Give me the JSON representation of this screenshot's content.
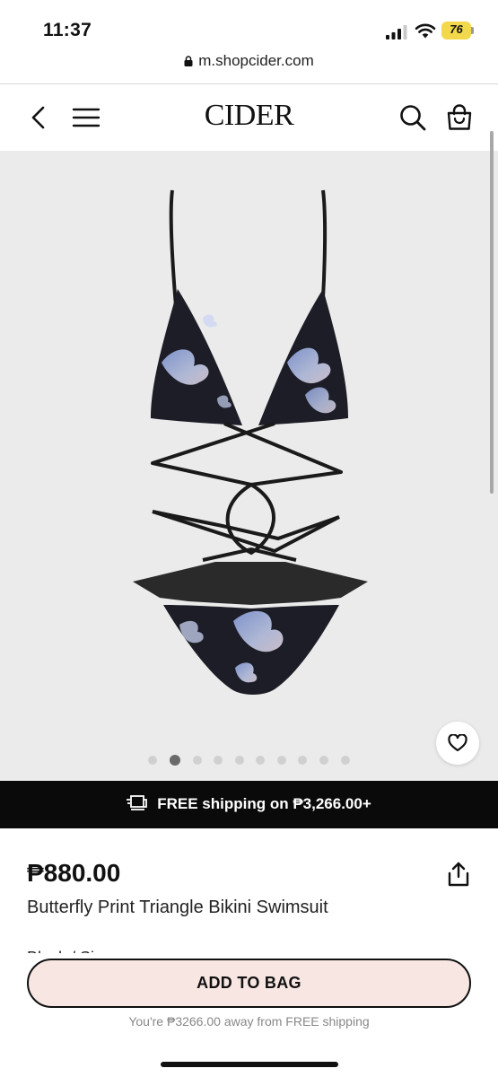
{
  "status_bar": {
    "time": "11:37",
    "battery": "76",
    "icons": [
      "signal-icon",
      "wifi-icon",
      "battery-icon"
    ]
  },
  "browser": {
    "url": "m.shopcider.com"
  },
  "nav": {
    "logo": "CIDER",
    "icons": [
      "back-icon",
      "menu-icon",
      "search-icon",
      "shopping-bag-icon"
    ]
  },
  "gallery": {
    "image_count": 10,
    "active_index": 1
  },
  "promo": {
    "text": "FREE shipping on ₱3,266.00+"
  },
  "product": {
    "price": "₱880.00",
    "title": "Butterfly Print Triangle Bikini Swimsuit",
    "color_peek": "Black / Size"
  },
  "bottom": {
    "add_to_bag": "ADD TO BAG",
    "shipping_note": "You're ₱3266.00 away from FREE shipping"
  },
  "colors": {
    "promo_bg": "#0a0a0a",
    "button_bg": "#f8e6e2",
    "gallery_bg": "#ebebeb",
    "battery": "#f2d84a"
  }
}
